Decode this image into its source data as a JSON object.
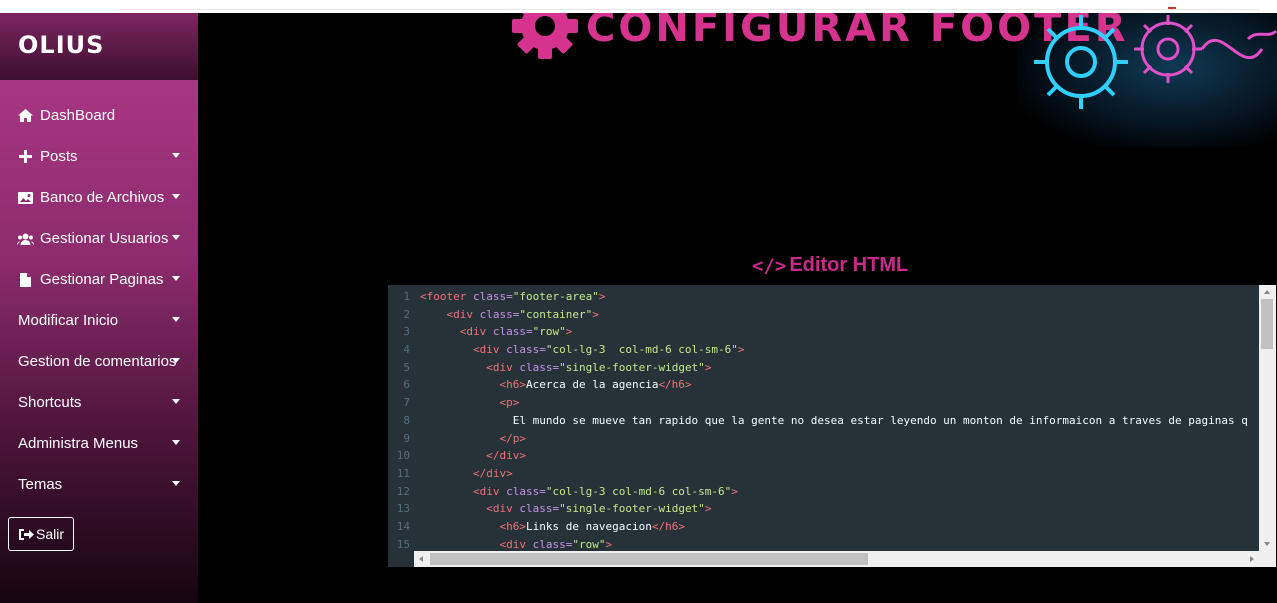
{
  "brand": "OLIUS",
  "sidebar": {
    "items": [
      {
        "label": "DashBoard",
        "icon": "home-icon",
        "caret": false
      },
      {
        "label": "Posts",
        "icon": "plus-icon",
        "caret": true
      },
      {
        "label": "Banco de Archivos",
        "icon": "image-icon",
        "caret": true
      },
      {
        "label": "Gestionar Usuarios",
        "icon": "users-icon",
        "caret": true
      },
      {
        "label": "Gestionar Paginas",
        "icon": "file-icon",
        "caret": true
      },
      {
        "label": "Modificar Inicio",
        "icon": "",
        "caret": true
      },
      {
        "label": "Gestion de comentarios",
        "icon": "",
        "caret": true
      },
      {
        "label": "Shortcuts",
        "icon": "",
        "caret": true
      },
      {
        "label": "Administra Menus",
        "icon": "",
        "caret": true
      },
      {
        "label": "Temas",
        "icon": "",
        "caret": true
      }
    ],
    "logout": "Salir"
  },
  "banner": {
    "title": "CONFIGURAR FOOTER"
  },
  "editor": {
    "title": "Editor HTML",
    "lines": [
      {
        "n": "1",
        "indent": "",
        "tokens": [
          [
            "tag",
            "<footer "
          ],
          [
            "attr",
            "class="
          ],
          [
            "str",
            "\"footer-area\""
          ],
          [
            "tag",
            ">"
          ]
        ]
      },
      {
        "n": "2",
        "indent": "    ",
        "tokens": [
          [
            "tag",
            "<div "
          ],
          [
            "attr",
            "class="
          ],
          [
            "str",
            "\"container\""
          ],
          [
            "tag",
            ">"
          ]
        ]
      },
      {
        "n": "3",
        "indent": "      ",
        "tokens": [
          [
            "tag",
            "<div "
          ],
          [
            "attr",
            "class="
          ],
          [
            "str",
            "\"row\""
          ],
          [
            "tag",
            ">"
          ]
        ]
      },
      {
        "n": "4",
        "indent": "        ",
        "tokens": [
          [
            "tag",
            "<div "
          ],
          [
            "attr",
            "class="
          ],
          [
            "str",
            "\"col-lg-3  col-md-6 col-sm-6\""
          ],
          [
            "tag",
            ">"
          ]
        ]
      },
      {
        "n": "5",
        "indent": "          ",
        "tokens": [
          [
            "tag",
            "<div "
          ],
          [
            "attr",
            "class="
          ],
          [
            "str",
            "\"single-footer-widget\""
          ],
          [
            "tag",
            ">"
          ]
        ]
      },
      {
        "n": "6",
        "indent": "            ",
        "tokens": [
          [
            "tag",
            "<h6>"
          ],
          [
            "txt",
            "Acerca de la agencia"
          ],
          [
            "tag",
            "</h6>"
          ]
        ]
      },
      {
        "n": "7",
        "indent": "            ",
        "tokens": [
          [
            "tag",
            "<p>"
          ]
        ]
      },
      {
        "n": "8",
        "indent": "              ",
        "tokens": [
          [
            "txt",
            "El mundo se mueve tan rapido que la gente no desea estar leyendo un monton de informaicon a traves de paginas q"
          ]
        ]
      },
      {
        "n": "9",
        "indent": "            ",
        "tokens": [
          [
            "tag",
            "</p>"
          ]
        ]
      },
      {
        "n": "10",
        "indent": "          ",
        "tokens": [
          [
            "tag",
            "</div>"
          ]
        ]
      },
      {
        "n": "11",
        "indent": "        ",
        "tokens": [
          [
            "tag",
            "</div>"
          ]
        ]
      },
      {
        "n": "12",
        "indent": "        ",
        "tokens": [
          [
            "tag",
            "<div "
          ],
          [
            "attr",
            "class="
          ],
          [
            "str",
            "\"col-lg-3 col-md-6 col-sm-6\""
          ],
          [
            "tag",
            ">"
          ]
        ]
      },
      {
        "n": "13",
        "indent": "          ",
        "tokens": [
          [
            "tag",
            "<div "
          ],
          [
            "attr",
            "class="
          ],
          [
            "str",
            "\"single-footer-widget\""
          ],
          [
            "tag",
            ">"
          ]
        ]
      },
      {
        "n": "14",
        "indent": "            ",
        "tokens": [
          [
            "tag",
            "<h6>"
          ],
          [
            "txt",
            "Links de navegacion"
          ],
          [
            "tag",
            "</h6>"
          ]
        ]
      },
      {
        "n": "15",
        "indent": "            ",
        "tokens": [
          [
            "tag",
            "<div "
          ],
          [
            "attr",
            "class="
          ],
          [
            "str",
            "\"row\""
          ],
          [
            "tag",
            ">"
          ]
        ]
      }
    ]
  },
  "colors": {
    "accent": "#c82a8c",
    "sidebar_top": "#b23a8c",
    "editor_bg": "#263238"
  }
}
